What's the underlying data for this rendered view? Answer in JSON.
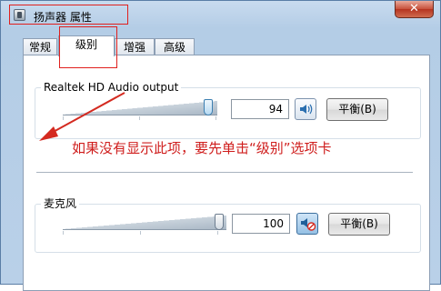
{
  "window": {
    "title": "扬声器 属性",
    "close_label": "✕"
  },
  "tabs": [
    {
      "label": "常规"
    },
    {
      "label": "级别"
    },
    {
      "label": "增强"
    },
    {
      "label": "高级"
    }
  ],
  "active_tab": "级别",
  "playback": {
    "device_label": "Realtek HD Audio output",
    "level": 94,
    "level_text": "94",
    "muted": false,
    "balance_label": "平衡(B)"
  },
  "microphone": {
    "device_label": "麦克风",
    "level": 100,
    "level_text": "100",
    "muted": true,
    "balance_label": "平衡(B)"
  },
  "annotation": {
    "text": "如果没有显示此项，要先单击“级别”选项卡",
    "color": "#cf1d1c"
  },
  "colors": {
    "highlight_box": "#e0201e",
    "window_frame": "#b9d0e8"
  },
  "icons": {
    "title": "speaker-device-icon",
    "speaker": "speaker-icon",
    "mic_muted": "speaker-muted-icon",
    "close": "close-icon",
    "arrow": "arrow-icon"
  }
}
